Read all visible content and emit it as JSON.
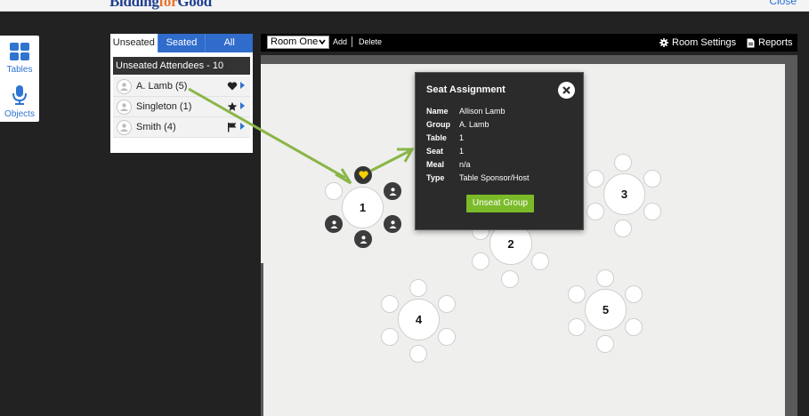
{
  "header": {
    "brand_main": "Bidding",
    "brand_accent": "for",
    "brand_end": "Good",
    "close_label": "Close"
  },
  "palette": {
    "items": [
      {
        "label": "Tables",
        "icon": "grid-icon"
      },
      {
        "label": "Objects",
        "icon": "microphone-icon"
      }
    ]
  },
  "attendees": {
    "tabs": [
      {
        "label": "Unseated"
      },
      {
        "label": "Seated"
      },
      {
        "label": "All"
      }
    ],
    "header": "Unseated Attendees - 10",
    "rows": [
      {
        "name": "A. Lamb (5)",
        "icon": "heart-icon"
      },
      {
        "name": "Singleton (1)",
        "icon": "star-icon"
      },
      {
        "name": "Smith (4)",
        "icon": "flag-icon"
      }
    ]
  },
  "toolbar": {
    "room_value": "Room One",
    "add_label": "Add",
    "delete_label": "Delete",
    "room_settings_label": "Room Settings",
    "reports_label": "Reports"
  },
  "tables": [
    {
      "number": "1"
    },
    {
      "number": "2"
    },
    {
      "number": "3"
    },
    {
      "number": "4"
    },
    {
      "number": "5"
    }
  ],
  "popup": {
    "title": "Seat Assignment",
    "fields": [
      {
        "key": "Name",
        "value": "Allison Lamb"
      },
      {
        "key": "Group",
        "value": "A. Lamb"
      },
      {
        "key": "Table",
        "value": "1"
      },
      {
        "key": "Seat",
        "value": "1"
      },
      {
        "key": "Meal",
        "value": "n/a"
      },
      {
        "key": "Type",
        "value": "Table Sponsor/Host"
      }
    ],
    "button_label": "Unseat Group"
  },
  "colors": {
    "accent_blue": "#2f6ccc",
    "button_green": "#7bbb2a",
    "arrow_green": "#8ab548",
    "heart_yellow": "#f5d000"
  }
}
